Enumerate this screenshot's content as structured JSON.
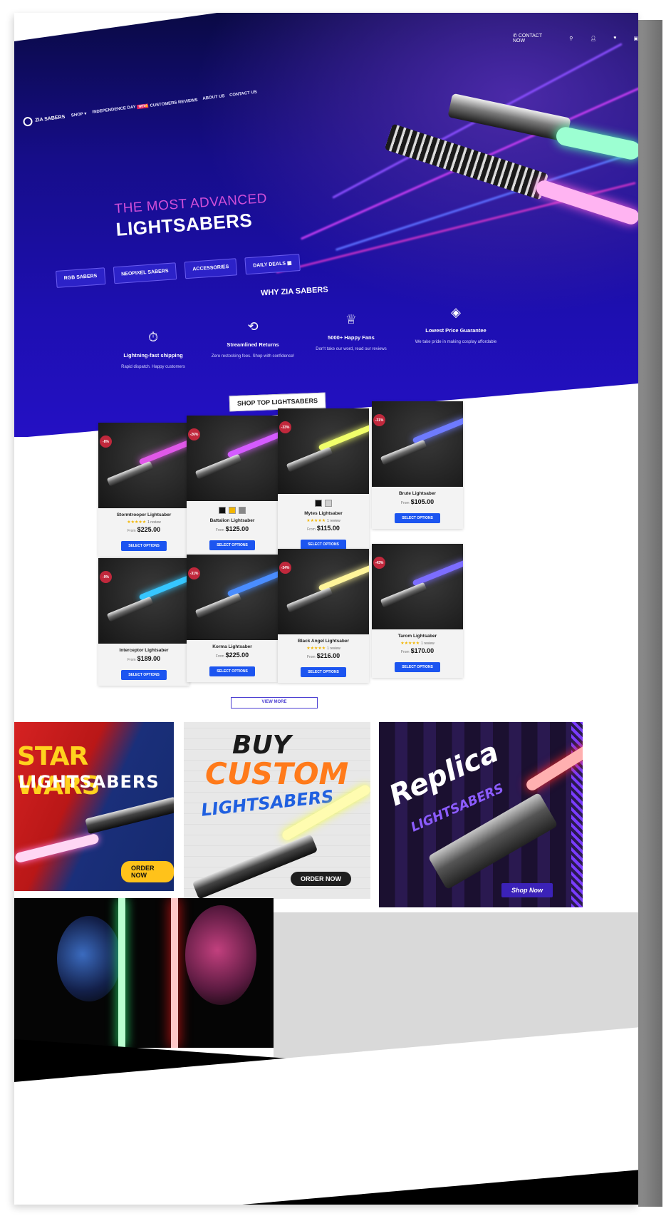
{
  "brand": {
    "name": "ZIA SABERS"
  },
  "nav": {
    "items": [
      "SHOP",
      "INDEPENDENCE DAY",
      "CUSTOMERS REVIEWS",
      "ABOUT US",
      "CONTACT US"
    ],
    "new_badge": "NEW",
    "phone": "CONTACT NOW",
    "icons": [
      "phone-icon",
      "search-icon",
      "user-icon",
      "heart-icon",
      "cart-icon"
    ]
  },
  "hero": {
    "line1": "THE MOST ADVANCED",
    "line2": "LIGHTSABERS",
    "categories": [
      "RGB SABERS",
      "NEOPIXEL SABERS",
      "ACCESSORIES",
      "DAILY DEALS"
    ],
    "why_title": "WHY ZIA SABERS",
    "features": [
      {
        "icon": "stopwatch-icon",
        "title": "Lightning-fast shipping",
        "desc": "Rapid dispatch. Happy customers"
      },
      {
        "icon": "box-return-icon",
        "title": "Streamlined Returns",
        "desc": "Zero restocking fees. Shop with confidence!"
      },
      {
        "icon": "trophy-icon",
        "title": "5000+ Happy Fans",
        "desc": "Don't take our word, read our reviews"
      },
      {
        "icon": "price-tag-icon",
        "title": "Lowest Price Guarantee",
        "desc": "We take pride in making cosplay affordable"
      }
    ]
  },
  "shop": {
    "title": "SHOP TOP LIGHTSABERS",
    "select_label": "SELECT OPTIONS",
    "from_label": "From",
    "products": [
      {
        "name": "Stormtrooper Lightsaber",
        "price": "$225.00",
        "discount": "-8%",
        "stars": "★★★★★",
        "reviews": "1 review",
        "blade": "#e058e8"
      },
      {
        "name": "Battalion Lightsaber",
        "price": "$125.00",
        "discount": "-26%",
        "stars": "",
        "reviews": "",
        "blade": "#d45bff"
      },
      {
        "name": "Mytes Lightsaber",
        "price": "$115.00",
        "discount": "-33%",
        "stars": "★★★★★",
        "reviews": "1 review",
        "blade": "#f1ff6a"
      },
      {
        "name": "Brute Lightsaber",
        "price": "$105.00",
        "discount": "-31%",
        "stars": "",
        "reviews": "",
        "blade": "#6e7bff"
      },
      {
        "name": "Interceptor Lightsaber",
        "price": "$189.00",
        "discount": "-9%",
        "stars": "",
        "reviews": "",
        "blade": "#36c6ff"
      },
      {
        "name": "Korma Lightsaber",
        "price": "$225.00",
        "discount": "-31%",
        "stars": "",
        "reviews": "",
        "blade": "#4a8dff"
      },
      {
        "name": "Black Angel Lightsaber",
        "price": "$216.00",
        "discount": "-34%",
        "stars": "★★★★★",
        "reviews": "1 review",
        "blade": "#fff59a"
      },
      {
        "name": "Tarom Lightsaber",
        "price": "$170.00",
        "discount": "-43%",
        "stars": "★★★★★",
        "reviews": "1 review",
        "blade": "#7c6dff"
      }
    ],
    "view_more": "VIEW MORE"
  },
  "banners": {
    "b1": {
      "title": "STAR WARS",
      "subtitle": "LIGHTSABERS",
      "cta": "ORDER NOW"
    },
    "b2": {
      "title1": "BUY",
      "title2": "CUSTOM",
      "title3": "LIGHTSABERS",
      "cta": "ORDER NOW"
    },
    "b3": {
      "title1": "Replica",
      "title2": "LIGHTSABERS",
      "cta": "Shop Now"
    }
  },
  "colors": {
    "accent": "#1c55f0",
    "hero_bg": "#1d0fb0",
    "headline_pink": "#d04fd8"
  }
}
